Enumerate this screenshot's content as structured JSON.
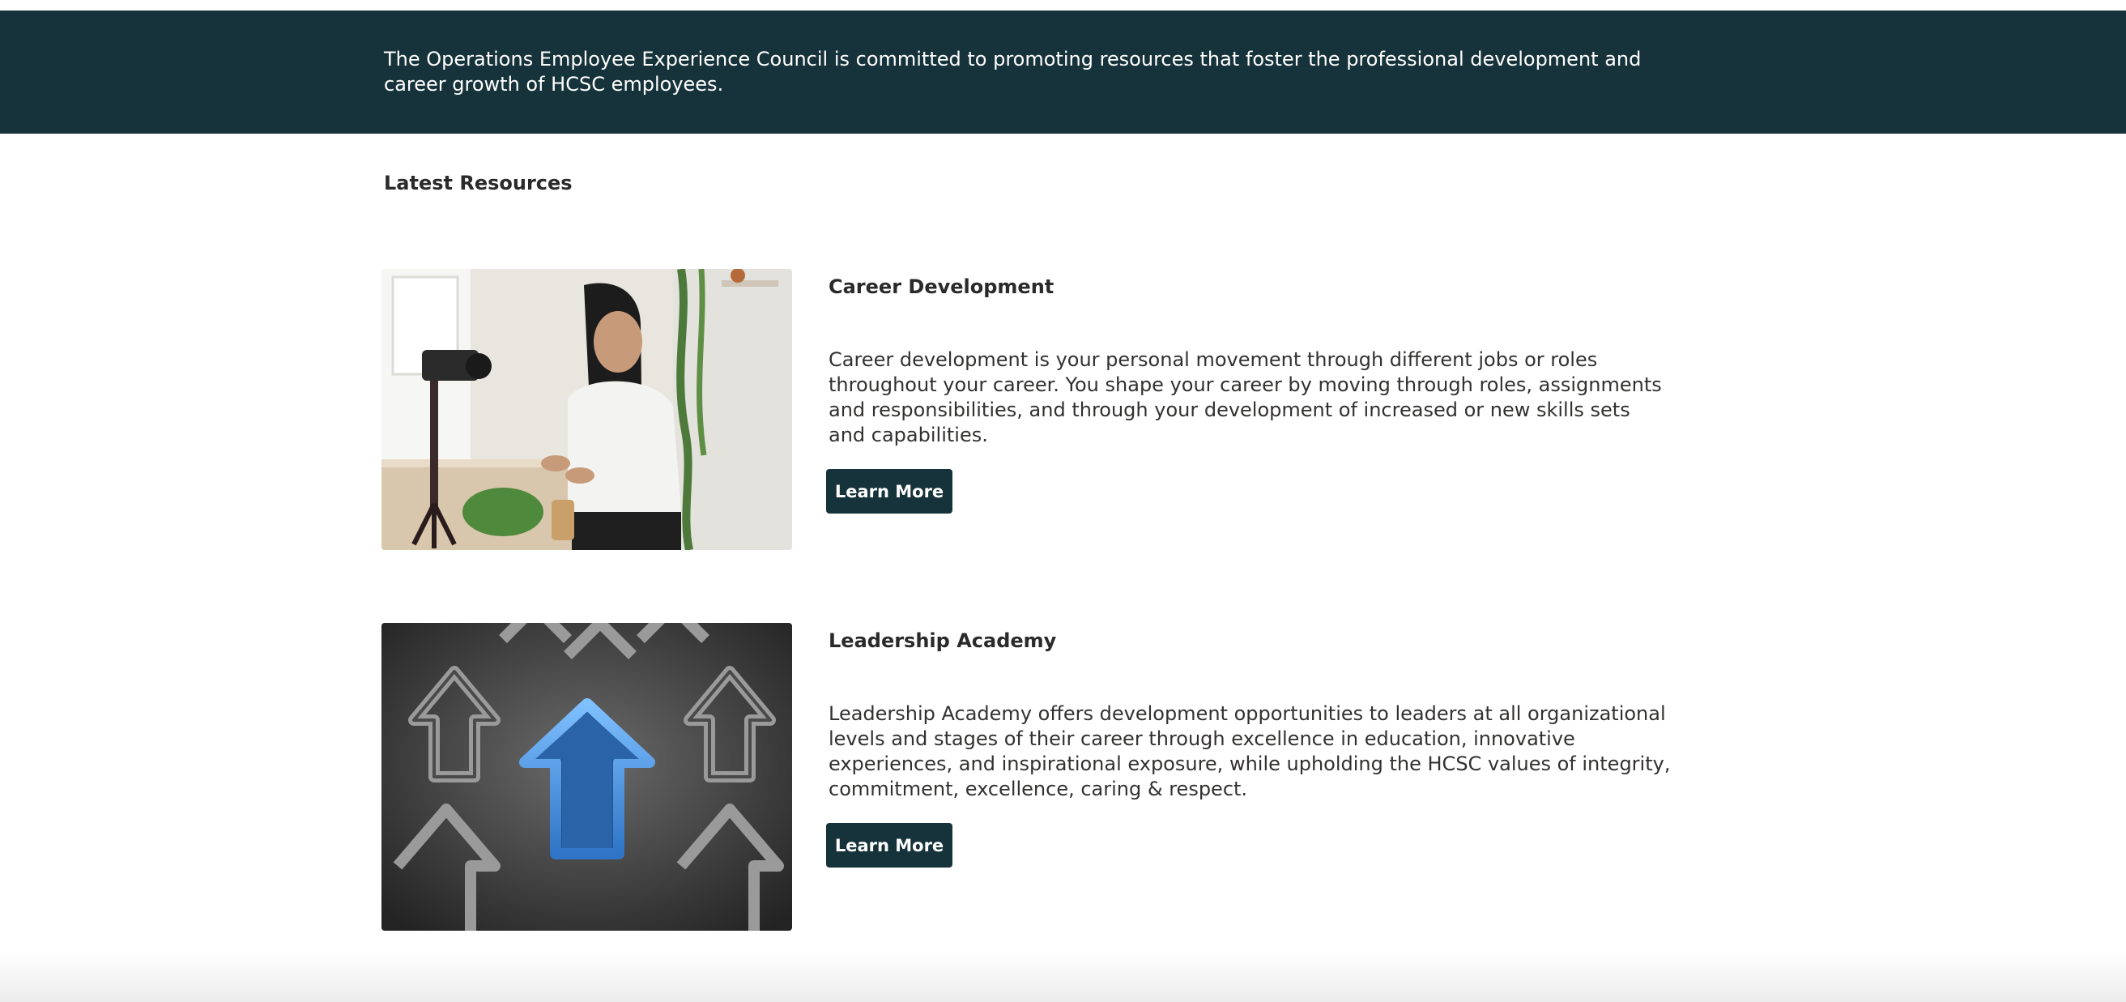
{
  "banner": {
    "text": "The Operations Employee Experience Council is committed to promoting resources that foster the professional development and career growth of HCSC employees."
  },
  "section": {
    "title": "Latest Resources"
  },
  "resources": [
    {
      "title": "Career Development",
      "description": "Career development is your personal movement through different jobs or roles throughout your career. You shape your career by moving through roles, assignments and responsibilities, and through your development of increased or new skills sets and capabilities.",
      "button_label": "Learn More",
      "image": "person-with-camera-photo"
    },
    {
      "title": "Leadership Academy",
      "description": "Leadership Academy offers development opportunities to leaders at all organizational levels and stages of their career through excellence in education, innovative experiences, and inspirational exposure, while upholding the HCSC values of integrity, commitment, excellence, caring & respect.",
      "button_label": "Learn More",
      "image": "blue-arrow-among-gray-arrows-photo"
    }
  ],
  "colors": {
    "banner_bg": "#16323a",
    "button_bg": "#16323a",
    "text": "#323130",
    "highlight_arrow": "#3d8fe0"
  }
}
